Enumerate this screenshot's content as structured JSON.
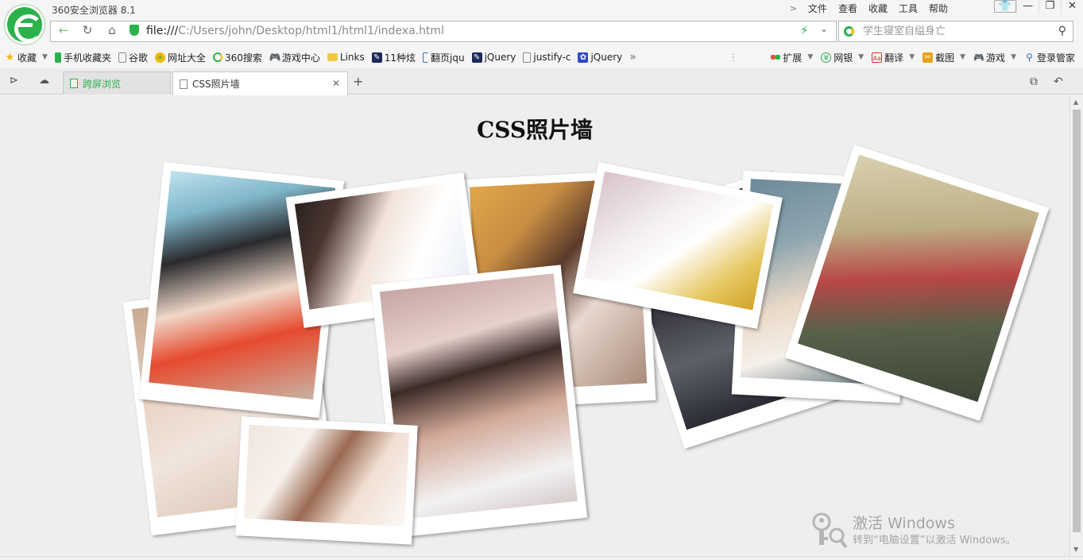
{
  "window": {
    "app_title": "360安全浏览器 8.1",
    "menu": [
      "文件",
      "查看",
      "收藏",
      "工具",
      "帮助"
    ],
    "controls": {
      "minimize": "—",
      "maximize": "❐",
      "close": "✕"
    }
  },
  "address": {
    "scheme": "file:///",
    "path": "C:/Users/john/Desktop/html1/html1/indexa.html"
  },
  "search": {
    "placeholder": "学生寝室自缢身亡"
  },
  "bookmarks": {
    "left": [
      {
        "label": "收藏",
        "icon": "star-icon"
      },
      {
        "label": "手机收藏夹",
        "icon": "phone-icon"
      },
      {
        "label": "谷歌",
        "icon": "page-icon"
      },
      {
        "label": "网址大全",
        "icon": "navi-icon"
      },
      {
        "label": "360搜索",
        "icon": "search360-icon"
      },
      {
        "label": "游戏中心",
        "icon": "gamepad-icon"
      },
      {
        "label": "Links",
        "icon": "folder-icon"
      },
      {
        "label": "11种炫",
        "icon": "jsdemo-icon"
      },
      {
        "label": "翻页jqu",
        "icon": "bracket-icon"
      },
      {
        "label": "jQuery",
        "icon": "jsdemo-icon"
      },
      {
        "label": "justify-c",
        "icon": "page-icon"
      },
      {
        "label": "jQuery",
        "icon": "baidu-icon"
      }
    ],
    "overflow": "»",
    "right": [
      {
        "label": "扩展",
        "icon": "apps-icon"
      },
      {
        "label": "网银",
        "icon": "bank-icon"
      },
      {
        "label": "翻译",
        "icon": "translate-icon"
      },
      {
        "label": "截图",
        "icon": "scissors-icon"
      },
      {
        "label": "游戏",
        "icon": "game-icon"
      },
      {
        "label": "登录管家",
        "icon": "login-icon"
      }
    ]
  },
  "tabs": [
    {
      "label": "跨屏浏览",
      "active": false
    },
    {
      "label": "CSS照片墙",
      "active": true
    }
  ],
  "page": {
    "title": "CSS照片墙"
  },
  "watermark": {
    "line1": "激活 Windows",
    "line2": "转到“电脑设置”以激活 Windows。"
  }
}
